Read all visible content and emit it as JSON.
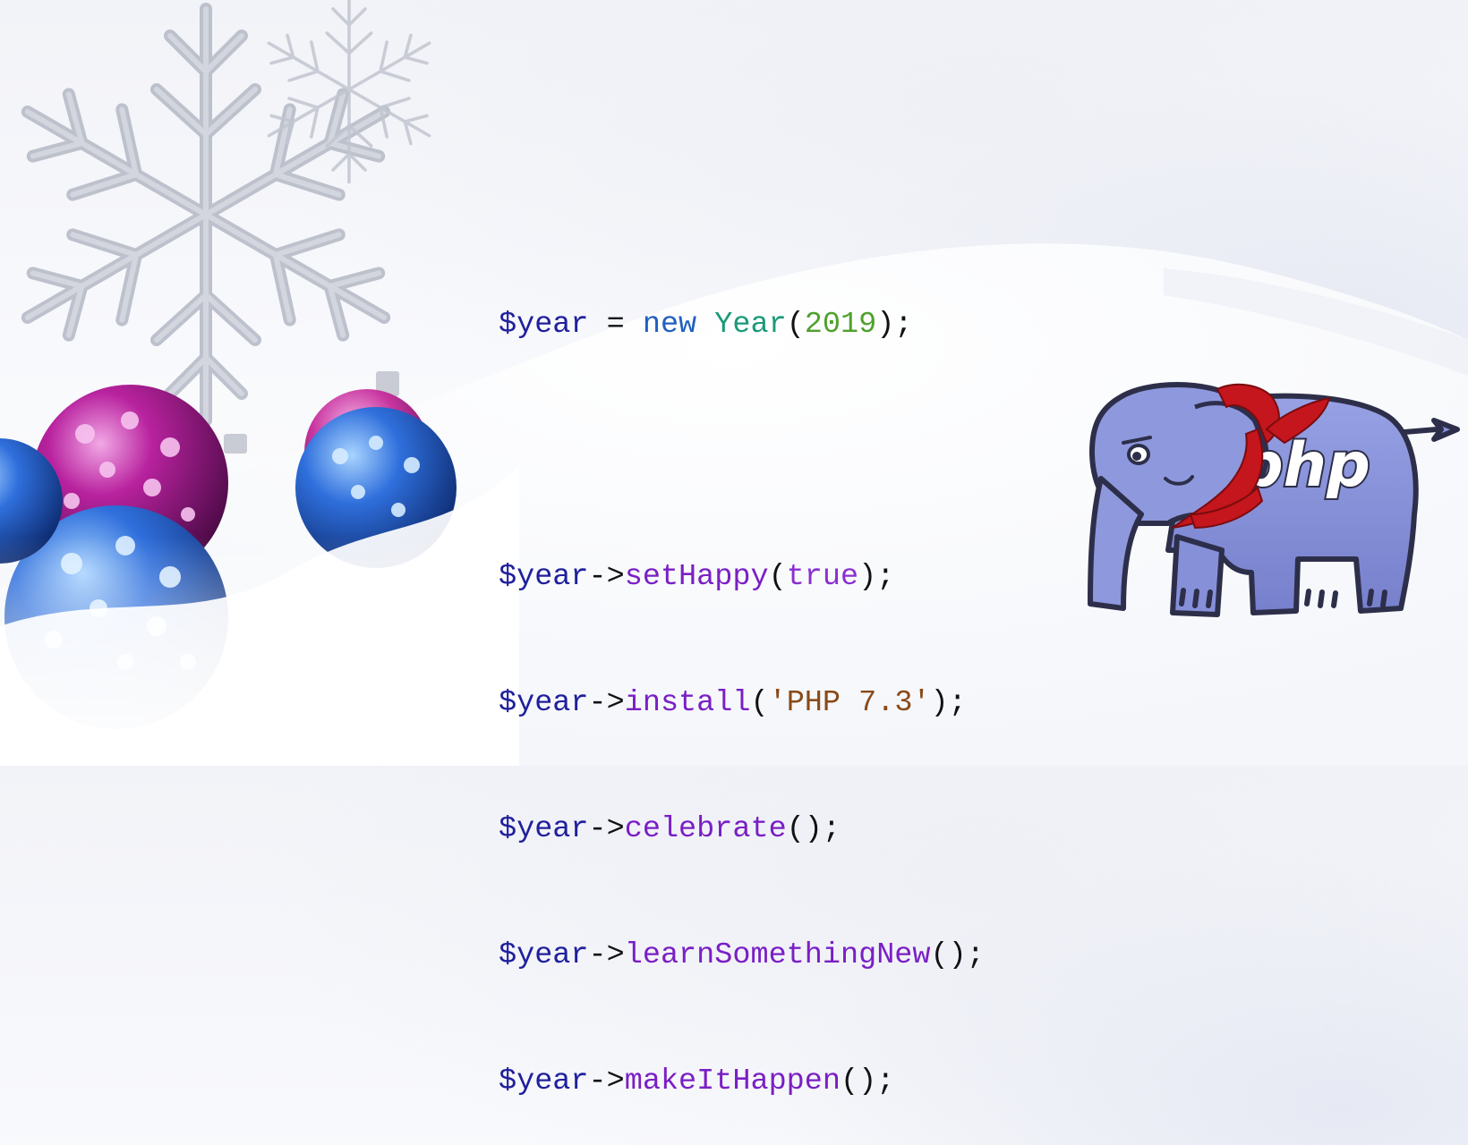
{
  "code": {
    "line1": {
      "var": "$year",
      "op": " = ",
      "kw": "new",
      "sp": " ",
      "cls": "Year",
      "open": "(",
      "num": "2019",
      "close": ");"
    },
    "line2": {
      "var": "$year",
      "arrow": "->",
      "fn": "setHappy",
      "open": "(",
      "arg": "true",
      "close": ");"
    },
    "line3": {
      "var": "$year",
      "arrow": "->",
      "fn": "install",
      "open": "(",
      "arg": "'PHP 7.3'",
      "close": ");"
    },
    "line4": {
      "var": "$year",
      "arrow": "->",
      "fn": "celebrate",
      "close": "();"
    },
    "line5": {
      "var": "$year",
      "arrow": "->",
      "fn": "learnSomethingNew",
      "close": "();"
    },
    "line6": {
      "var": "$year",
      "arrow": "->",
      "fn": "makeItHappen",
      "close": "();"
    }
  },
  "mascot": {
    "logo_text": "php",
    "scarf_color": "#c4161c",
    "body_color": "#8893d8"
  },
  "colors": {
    "variable": "#20209c",
    "keyword": "#1f5fbf",
    "class": "#1a9a7a",
    "number": "#4fa12c",
    "method": "#7a1fc4",
    "boolean": "#8a2fd0",
    "string": "#8a4a18"
  }
}
